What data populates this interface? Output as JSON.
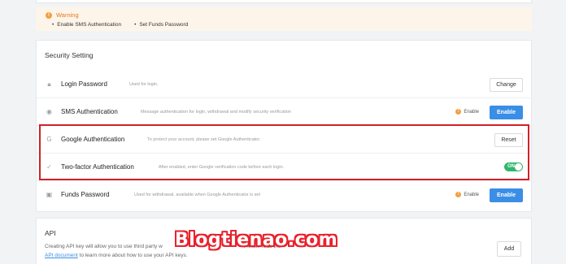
{
  "warning": {
    "title": "Warning",
    "items": [
      "Enable SMS Authentication",
      "Set Funds Password"
    ]
  },
  "security": {
    "title": "Security Setting",
    "rows": [
      {
        "name": "Login Password",
        "desc": "Used for login.",
        "icon": "lock-icon",
        "action": "Change"
      },
      {
        "name": "SMS Authentication",
        "desc": "Message authentication for login, withdrawal and modify security verification",
        "icon": "sms-icon",
        "status": "Enable",
        "action": "Enable"
      },
      {
        "name": "Google Authentication",
        "desc": "To protect your account, please set Google Authenticator.",
        "icon": "google-icon",
        "action": "Reset"
      },
      {
        "name": "Two-factor Authentication",
        "desc": "After enabled, enter Google verification code before each login.",
        "icon": "check-shield-icon",
        "toggle": "ON"
      },
      {
        "name": "Funds Password",
        "desc": "Used for withdrawal, available when Google Authenticator is set",
        "icon": "wallet-icon",
        "status": "Enable",
        "action": "Enable"
      }
    ]
  },
  "api": {
    "title": "API",
    "desc_part1": "Creating API key will allow you to use third party w",
    "desc_part2": "Please read the",
    "link": "API document",
    "desc_part3": "to learn more about how to use your API keys.",
    "add_label": "Add"
  },
  "watermark": "Blogtienao.com",
  "colors": {
    "accent": "#3a8ee6",
    "warning": "#e07a1f",
    "toggle_on": "#2fb86b",
    "highlight_border": "#d32027"
  }
}
